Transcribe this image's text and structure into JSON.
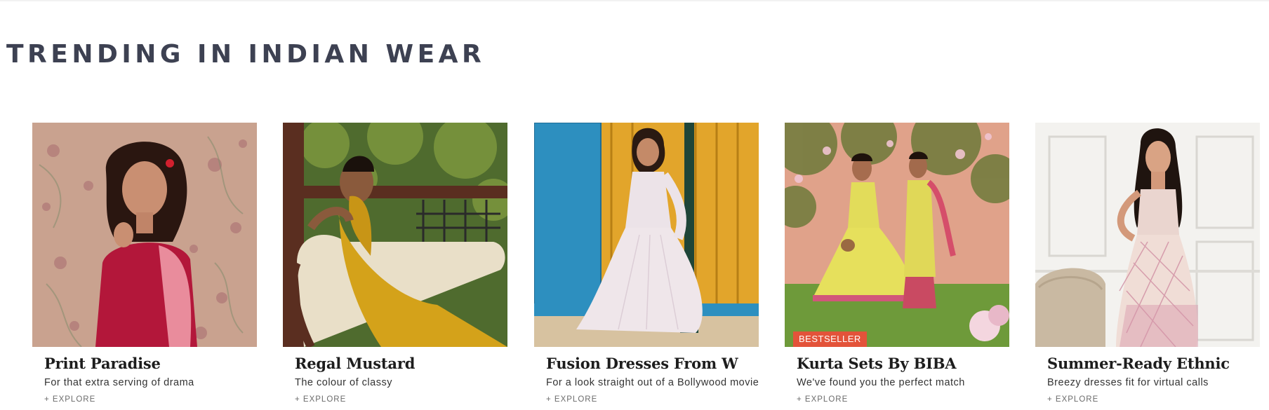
{
  "section": {
    "title": "TRENDING IN INDIAN WEAR"
  },
  "cards": [
    {
      "title": "Print Paradise",
      "subtitle": "For that extra serving of drama",
      "cta": "+ EXPLORE",
      "image": "woman-red-pink-kurta-floral-wallpaper"
    },
    {
      "title": "Regal Mustard",
      "subtitle": "The colour of classy",
      "cta": "+ EXPLORE",
      "image": "woman-mustard-dress-on-sofa"
    },
    {
      "title": "Fusion Dresses From W",
      "subtitle": "For a look straight out of a Bollywood movie",
      "cta": "+ EXPLORE",
      "image": "woman-white-anarkali-yellow-wall"
    },
    {
      "title": "Kurta Sets By BIBA",
      "subtitle": "We've found you the perfect match",
      "cta": "+ EXPLORE",
      "badge": "BESTSELLER",
      "image": "two-women-yellow-kurta-garden"
    },
    {
      "title": "Summer-Ready Ethnic",
      "subtitle": "Breezy dresses fit for virtual calls",
      "cta": "+ EXPLORE",
      "image": "woman-printed-dress-white-room"
    }
  ],
  "colors": {
    "title": "#3d4152",
    "badge": "#e3533a"
  }
}
